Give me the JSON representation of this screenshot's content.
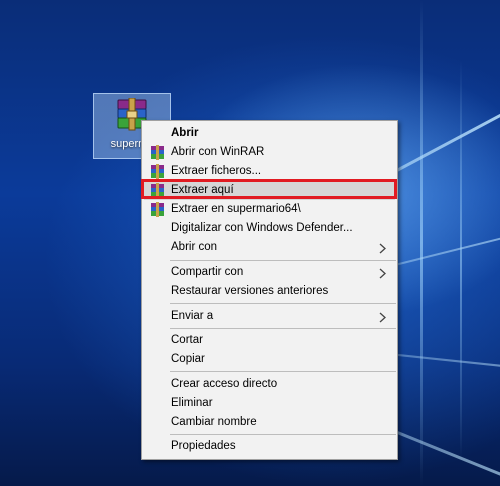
{
  "desktop_icon": {
    "label": "superma",
    "icon": "winrar-archive-icon"
  },
  "context_menu": {
    "open": "Abrir",
    "open_with_winrar": "Abrir con WinRAR",
    "extract_files": "Extraer ficheros...",
    "extract_here": "Extraer aquí",
    "extract_to": "Extraer en supermario64\\",
    "scan_defender": "Digitalizar con Windows Defender...",
    "open_with": "Abrir con",
    "share_with": "Compartir con",
    "restore_versions": "Restaurar versiones anteriores",
    "send_to": "Enviar a",
    "cut": "Cortar",
    "copy": "Copiar",
    "create_shortcut": "Crear acceso directo",
    "delete": "Eliminar",
    "rename": "Cambiar nombre",
    "properties": "Propiedades"
  },
  "colors": {
    "highlight_box": "#e11b22",
    "menu_bg": "#f2f2f2",
    "hover_bg": "#d6d6d6"
  }
}
